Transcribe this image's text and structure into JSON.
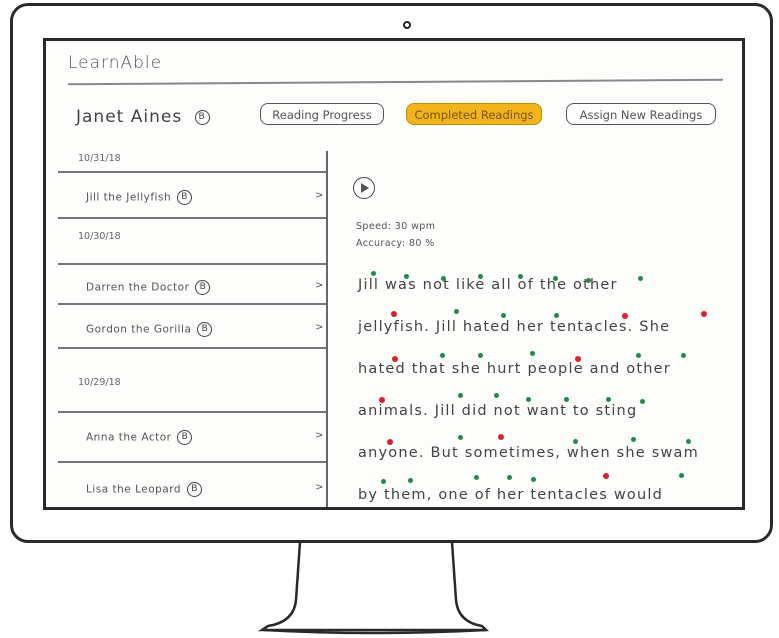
{
  "app": {
    "title": "LearnAble",
    "user_name": "Janet Aines",
    "user_badge": "B"
  },
  "nav": {
    "reading_progress": "Reading Progress",
    "completed_readings": "Completed Readings",
    "assign_new_readings": "Assign New Readings",
    "active_color": "#f2b41b"
  },
  "readings": {
    "groups": [
      {
        "date": "10/31/18",
        "items": [
          {
            "title": "Jill the Jellyfish",
            "badge": "B"
          }
        ]
      },
      {
        "date": "10/30/18",
        "items": [
          {
            "title": "Darren the Doctor",
            "badge": "B"
          },
          {
            "title": "Gordon the Gorilla",
            "badge": "B"
          }
        ]
      },
      {
        "date": "10/29/18",
        "items": [
          {
            "title": "Anna the Actor",
            "badge": "B"
          },
          {
            "title": "Lisa the Leopard",
            "badge": "B"
          }
        ]
      }
    ],
    "chevron": ">"
  },
  "detail": {
    "speed": "Speed: 30 wpm",
    "accuracy": "Accuracy: 80 %",
    "passage_lines": [
      "Jill was not like all of the other",
      "jellyfish. Jill hated her tentacles. She",
      "hated that she hurt people and other",
      "animals. Jill did not want to sting",
      "anyone. But sometimes, when she swam",
      "by them, one of her tentacles would"
    ],
    "colors": {
      "correct": "#1f8a4a",
      "error": "#e01f2a"
    }
  }
}
